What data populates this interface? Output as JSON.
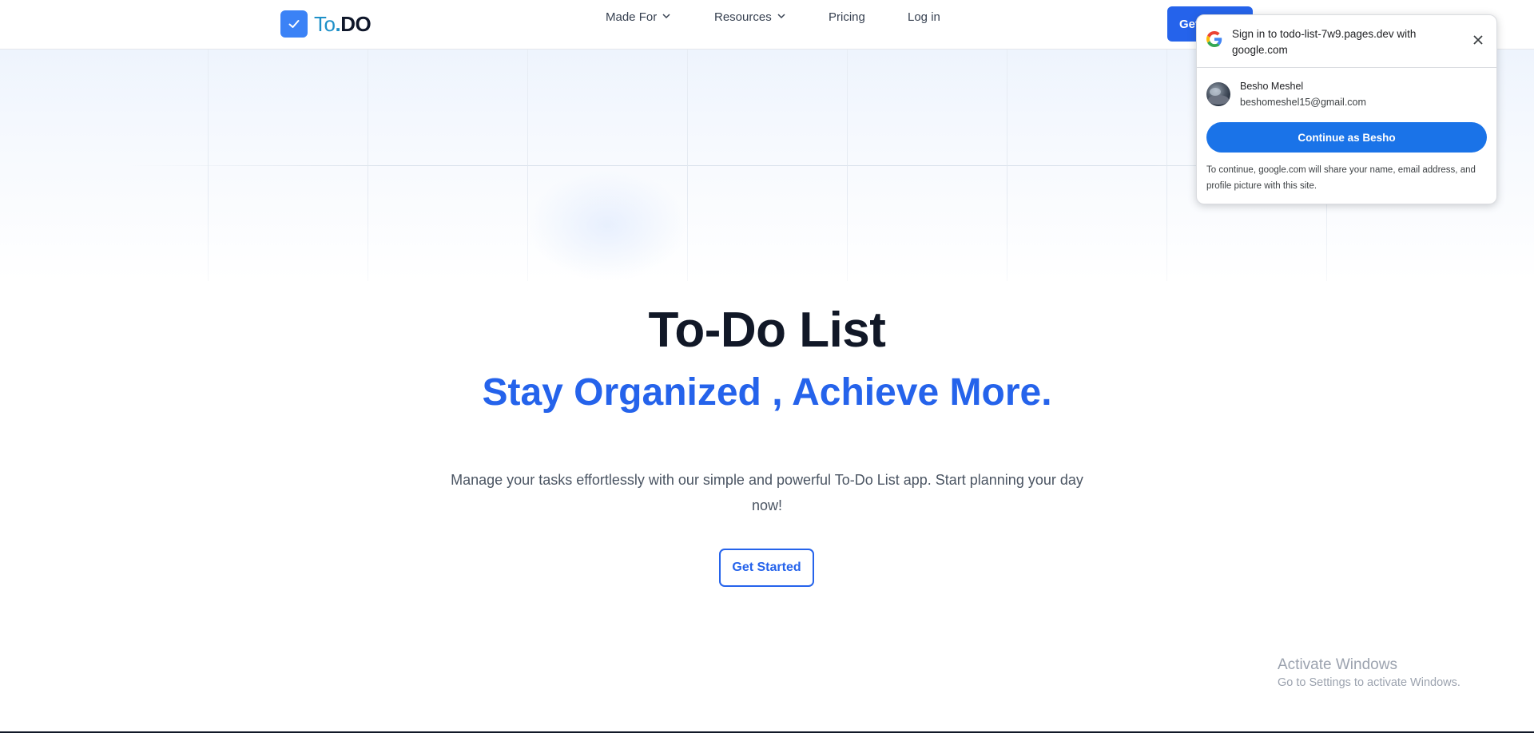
{
  "navbar": {
    "logo_text_to": "To",
    "logo_text_dot": ".",
    "logo_text_do": "DO",
    "links": [
      {
        "label": "Made For",
        "has_dropdown": true
      },
      {
        "label": "Resources",
        "has_dropdown": true
      },
      {
        "label": "Pricing",
        "has_dropdown": false
      },
      {
        "label": "Log in",
        "has_dropdown": false
      }
    ],
    "cta_label": "Get Started"
  },
  "hero": {
    "title": "To-Do List",
    "subtitle": "Stay Organized , Achieve More.",
    "description": "Manage your tasks effortlessly with our simple and powerful To-Do List app. Start planning your day now!",
    "button_label": "Get Started"
  },
  "google_popup": {
    "title": "Sign in to todo-list-7w9.pages.dev with google.com",
    "account_name": "Besho Meshel",
    "account_email": "beshomeshel15@gmail.com",
    "continue_label": "Continue as Besho",
    "note": "To continue, google.com will share your name, email address, and profile picture with this site."
  },
  "watermark": {
    "line1": "Activate Windows",
    "line2": "Go to Settings to activate Windows."
  },
  "colors": {
    "brand_blue": "#2563eb",
    "google_blue": "#1a73e8",
    "logo_box": "#3b82f6"
  }
}
